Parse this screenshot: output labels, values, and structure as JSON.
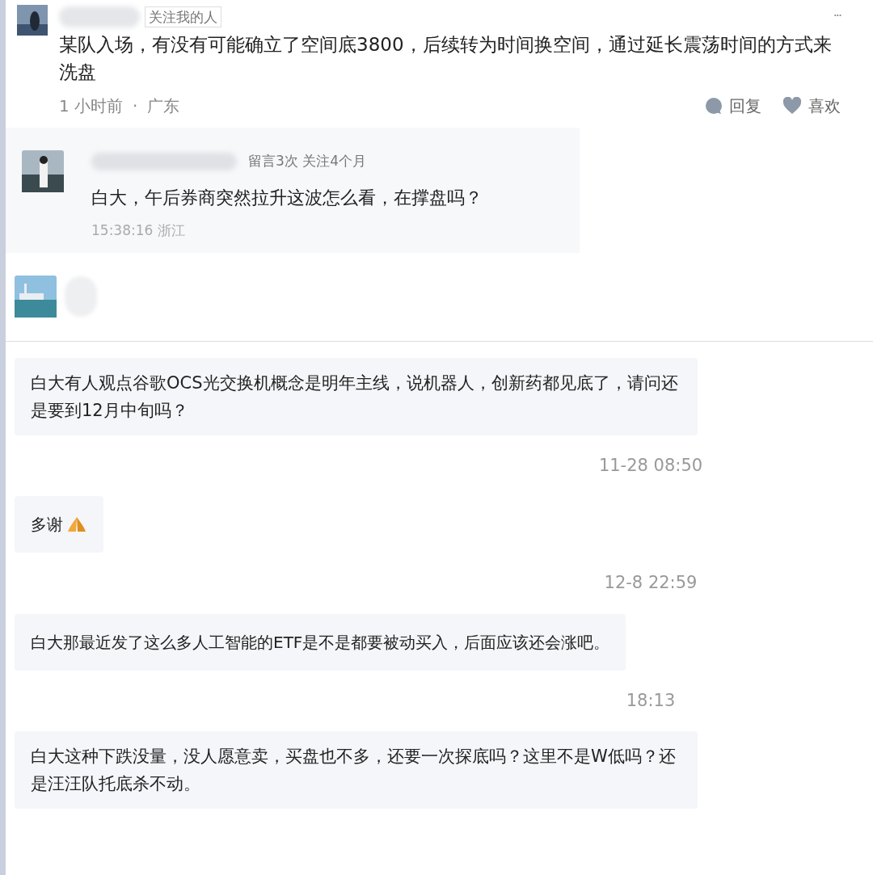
{
  "comment": {
    "tag": "关注我的人",
    "text": "某队入场，有没有可能确立了空间底3800，后续转为时间换空间，通过延长震荡时间的方式来洗盘",
    "time": "1 小时前",
    "separator": "·",
    "location": "广东",
    "more": "···",
    "actions": [
      {
        "kind": "reply",
        "label": "回复"
      },
      {
        "kind": "like",
        "label": "喜欢"
      }
    ]
  },
  "reply": {
    "stats": "留言3次 关注4个月",
    "text": "白大，午后券商突然拉升这波怎么看，在撑盘吗？",
    "time": "15:38:16 浙江"
  },
  "messages": [
    {
      "kind": "bubble",
      "text": "白大有人观点谷歌OCS光交换机概念是明年主线，说机器人，创新药都见底了，请问还是要到12月中旬吗？"
    },
    {
      "kind": "time",
      "text": "11-28 08:50"
    },
    {
      "kind": "bubble_thanks",
      "text": "多谢"
    },
    {
      "kind": "time",
      "text": "12-8 22:59"
    },
    {
      "kind": "bubble",
      "text": "白大那最近发了这么多人工智能的ETF是不是都要被动买入，后面应该还会涨吧。"
    },
    {
      "kind": "time",
      "text": "18:13"
    },
    {
      "kind": "bubble",
      "text": "白大这种下跌没量，没人愿意卖，买盘也不多，还要一次探底吗？这里不是W低吗？还是汪汪队托底杀不动。"
    }
  ]
}
